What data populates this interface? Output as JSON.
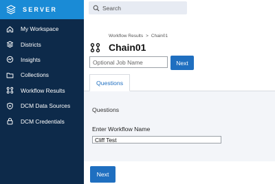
{
  "brand": {
    "name": "SERVER",
    "color": "#1a8bd6"
  },
  "sidebar": {
    "items": [
      {
        "label": "My Workspace",
        "icon": "home-icon"
      },
      {
        "label": "Districts",
        "icon": "layers-icon"
      },
      {
        "label": "Insights",
        "icon": "insights-icon"
      },
      {
        "label": "Collections",
        "icon": "folder-icon"
      },
      {
        "label": "Workflow Results",
        "icon": "workflow-icon"
      },
      {
        "label": "DCM Data Sources",
        "icon": "shield-icon"
      },
      {
        "label": "DCM Credentials",
        "icon": "lock-icon"
      }
    ]
  },
  "search": {
    "placeholder": "Search"
  },
  "breadcrumb": {
    "parent": "Workflow Results",
    "separator": ">",
    "current": "Chain01"
  },
  "page": {
    "title": "Chain01",
    "job_name_placeholder": "Optional Job Name",
    "next_label": "Next"
  },
  "tabs": [
    {
      "label": "Questions",
      "active": true
    }
  ],
  "questions": {
    "section_title": "Questions",
    "workflow_name_label": "Enter Workflow Name",
    "workflow_name_value": "Cliff Test"
  },
  "footer": {
    "next_label": "Next"
  },
  "colors": {
    "sidebar_bg": "#0d2a4a",
    "accent": "#1f6fc0"
  }
}
